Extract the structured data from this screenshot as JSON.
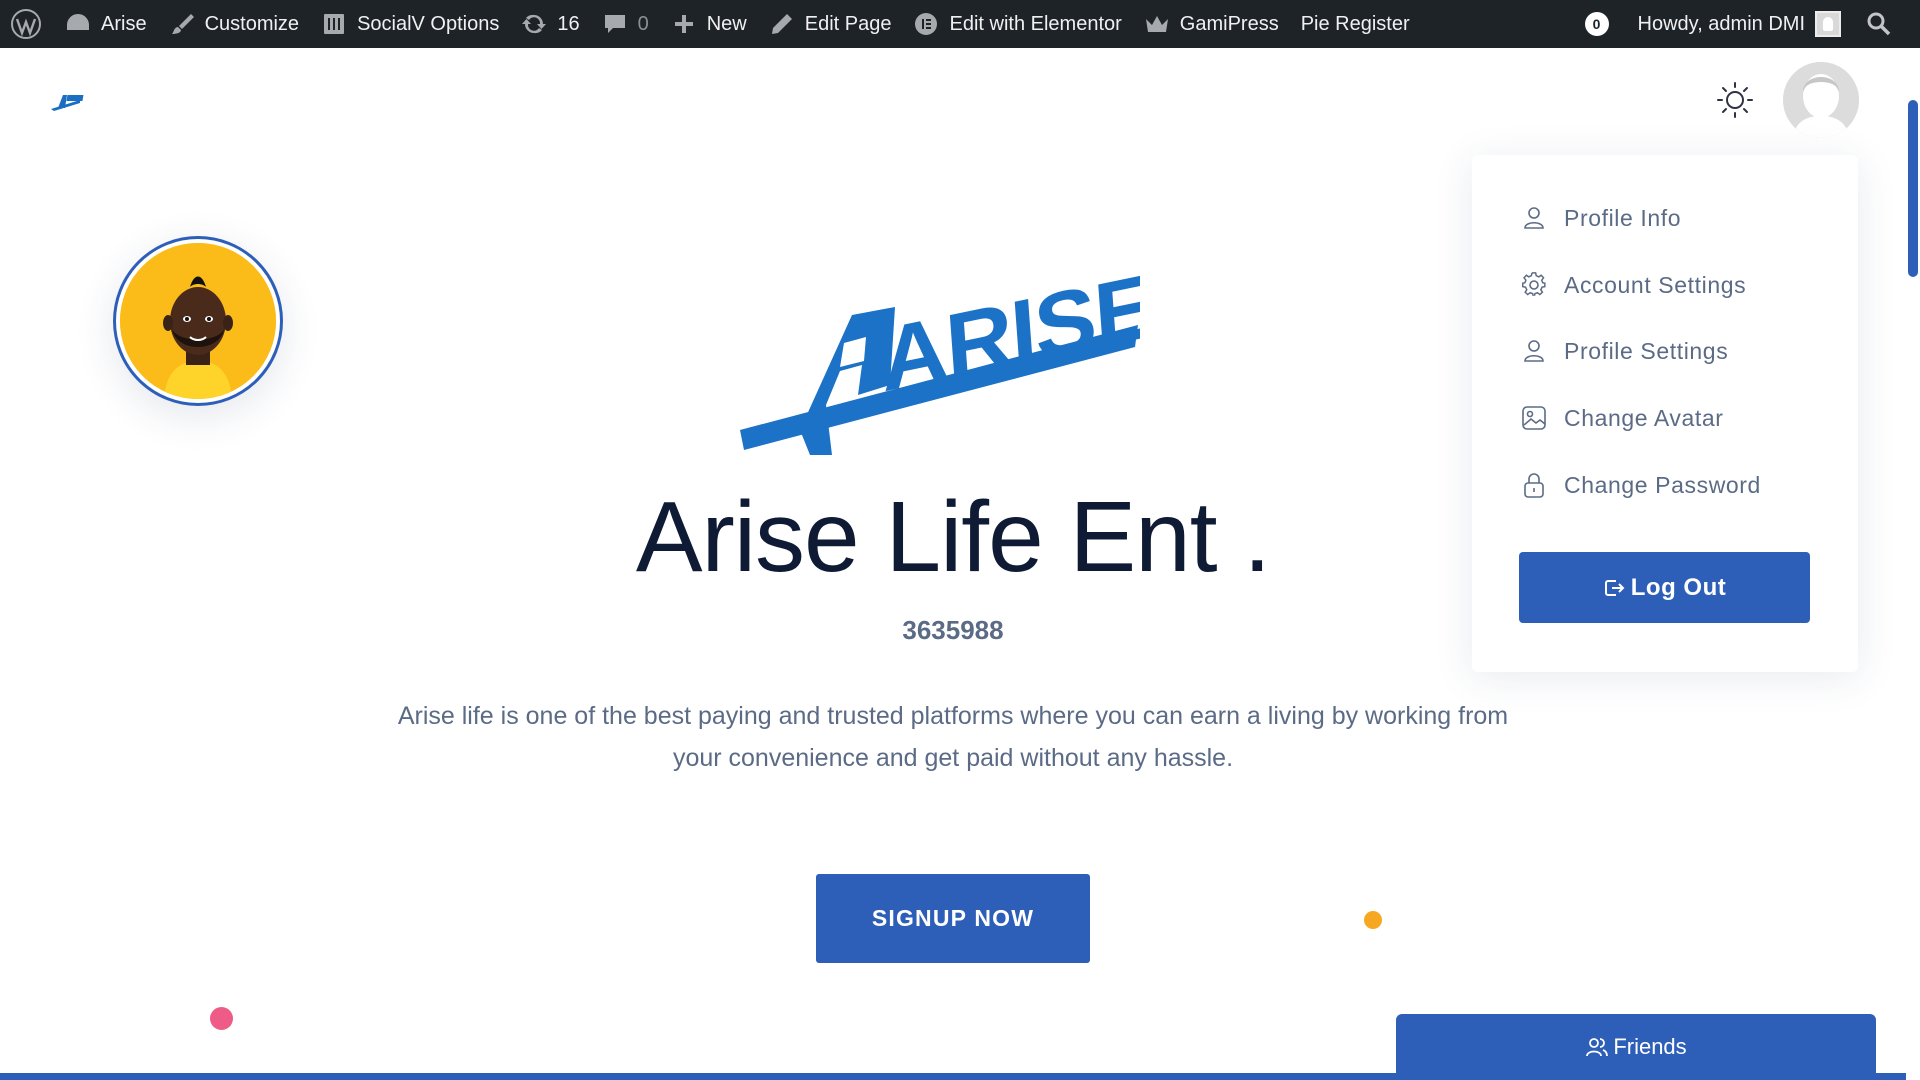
{
  "admin_bar": {
    "site_name": "Arise",
    "customize": "Customize",
    "socialv_options": "SocialV Options",
    "updates_count": "16",
    "comments_count": "0",
    "new": "New",
    "edit_page": "Edit Page",
    "edit_elementor": "Edit with Elementor",
    "gamipress": "GamiPress",
    "pie_register": "Pie Register",
    "notifications_count": "0",
    "howdy": "Howdy, admin DMI"
  },
  "user_menu": {
    "items": [
      {
        "label": "Profile Info",
        "icon": "user-icon"
      },
      {
        "label": "Account Settings",
        "icon": "gear-icon"
      },
      {
        "label": "Profile Settings",
        "icon": "user-icon"
      },
      {
        "label": "Change Avatar",
        "icon": "image-icon"
      },
      {
        "label": "Change Password",
        "icon": "lock-icon"
      }
    ],
    "logout_label": "Log Out"
  },
  "hero": {
    "logo_text": "ARISE",
    "title": "Arise Life Ent .",
    "id": "3635988",
    "description": "Arise life is one of the best paying and trusted platforms where you can earn a living by working from your convenience and get paid without any hassle.",
    "signup_label": "SIGNUP NOW"
  },
  "friends_bar": {
    "label": "Friends"
  },
  "colors": {
    "primary": "#2d5fb8",
    "admin_bar": "#1d2327",
    "heading": "#0f1a35",
    "muted": "#5b6b86",
    "accent_orange": "#f7a823",
    "accent_pink": "#ee5b86",
    "avatar_yellow": "#fbbc1a"
  }
}
